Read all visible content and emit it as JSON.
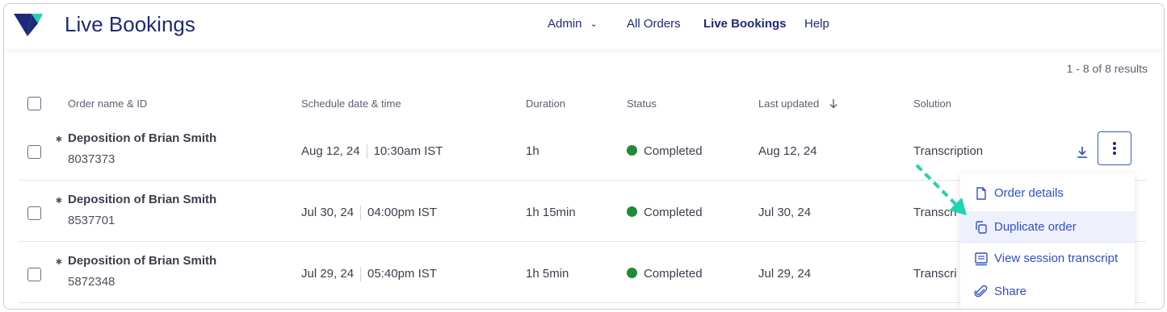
{
  "header": {
    "title": "Live Bookings",
    "nav": [
      {
        "label": "Admin",
        "has_dropdown": true
      },
      {
        "label": "All Orders"
      },
      {
        "label": "Live Bookings",
        "active": true
      },
      {
        "label": "Help"
      }
    ]
  },
  "results_summary": "1 - 8 of 8 results",
  "table": {
    "columns": [
      "Order name & ID",
      "Schedule date & time",
      "Duration",
      "Status",
      "Last updated",
      "Solution"
    ],
    "sort_icon": "arrow-down-icon",
    "rows": [
      {
        "name": "Deposition of Brian Smith",
        "id": "8037373",
        "date": "Aug 12, 24",
        "time": "10:30am IST",
        "duration": "1h",
        "status": "Completed",
        "last_updated": "Aug 12, 24",
        "solution": "Transcription"
      },
      {
        "name": "Deposition of Brian Smith",
        "id": "8537701",
        "date": "Jul 30, 24",
        "time": "04:00pm IST",
        "duration": "1h 15min",
        "status": "Completed",
        "last_updated": "Jul 30, 24",
        "solution": "Transcri"
      },
      {
        "name": "Deposition of Brian Smith",
        "id": "5872348",
        "date": "Jul 29, 24",
        "time": "05:40pm IST",
        "duration": "1h 5min",
        "status": "Completed",
        "last_updated": "Jul 29, 24",
        "solution": "Transcri"
      }
    ]
  },
  "row_menu": {
    "items": [
      {
        "label": "Order details",
        "icon": "document-icon"
      },
      {
        "label": "Duplicate order",
        "icon": "copy-icon",
        "highlighted": true
      },
      {
        "label": "View session transcript",
        "icon": "transcript-icon"
      },
      {
        "label": "Share",
        "icon": "paperclip-icon"
      }
    ]
  },
  "colors": {
    "brand_navy": "#1e2a78",
    "accent_teal": "#22d3b0",
    "link_blue": "#2d4fd0",
    "status_green": "#1f8a3a",
    "menu_highlight": "#eef1fb"
  }
}
